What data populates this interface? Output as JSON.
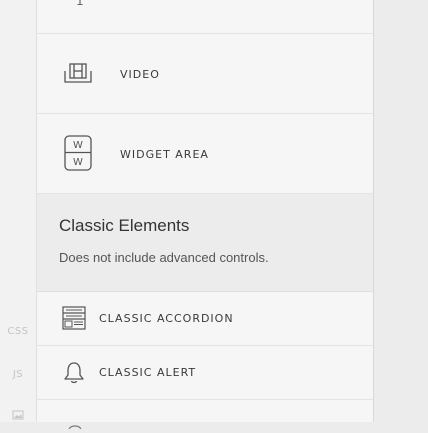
{
  "rail": {
    "items": [
      {
        "label": "CSS"
      },
      {
        "label": "JS"
      }
    ]
  },
  "elements": {
    "top_partial_label": "1",
    "items": [
      {
        "label": "VIDEO",
        "icon": "video-film-icon"
      },
      {
        "label": "WIDGET AREA",
        "icon": "widget-area-icon"
      }
    ]
  },
  "classic": {
    "title": "Classic Elements",
    "description": "Does not include advanced controls.",
    "items": [
      {
        "label": "CLASSIC ACCORDION",
        "icon": "accordion-icon"
      },
      {
        "label": "CLASSIC ALERT",
        "icon": "bell-icon"
      }
    ]
  }
}
